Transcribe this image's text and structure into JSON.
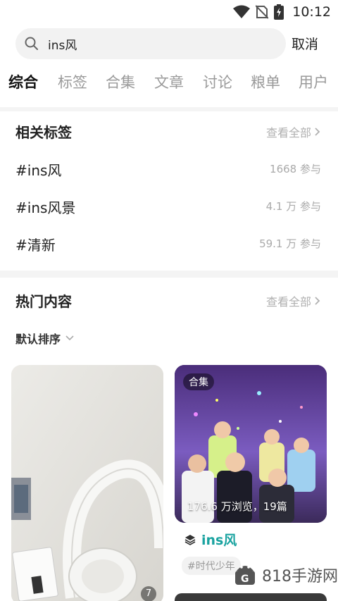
{
  "status_bar": {
    "time": "10:12",
    "icons": [
      "wifi-icon",
      "no-sim-icon",
      "battery-charging-icon"
    ]
  },
  "search": {
    "query": "ins风",
    "cancel_label": "取消"
  },
  "tabs": [
    {
      "label": "综合",
      "active": true
    },
    {
      "label": "标签",
      "active": false
    },
    {
      "label": "合集",
      "active": false
    },
    {
      "label": "文章",
      "active": false
    },
    {
      "label": "讨论",
      "active": false
    },
    {
      "label": "粮单",
      "active": false
    },
    {
      "label": "用户",
      "active": false
    }
  ],
  "related_tags": {
    "title": "相关标签",
    "see_all": "查看全部",
    "items": [
      {
        "name": "#ins风",
        "count": "1668 参与"
      },
      {
        "name": "#ins风景",
        "count": "4.1 万 参与"
      },
      {
        "name": "#清新",
        "count": "59.1 万 参与"
      }
    ]
  },
  "hot_content": {
    "title": "热门内容",
    "see_all": "查看全部",
    "sort_label": "默认排序",
    "left_tile": {
      "image_count": "7"
    },
    "right_tile": {
      "badge": "合集",
      "stats": "176.6 万浏览，19篇",
      "name": "ins风",
      "hashtag": "#时代少年"
    }
  },
  "watermark": {
    "text": "818手游网"
  },
  "colors": {
    "accent_teal": "#1aa3a0",
    "muted_text": "#9a9a9a",
    "background": "#f4f4f4"
  }
}
